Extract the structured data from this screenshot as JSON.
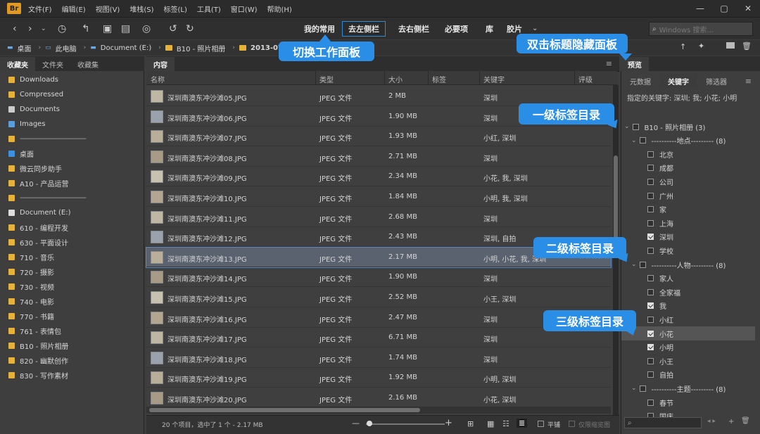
{
  "app": {
    "logo": "Br"
  },
  "menu": [
    "文件(F)",
    "编辑(E)",
    "视图(V)",
    "堆栈(S)",
    "标签(L)",
    "工具(T)",
    "窗口(W)",
    "帮助(H)"
  ],
  "workspaces": [
    "我的常用",
    "去左侧栏",
    "去右侧栏",
    "必要项",
    "库",
    "胶片"
  ],
  "active_workspace_index": 1,
  "search": {
    "placeholder": "Windows 搜索..."
  },
  "breadcrumb": [
    "桌面",
    "此电脑",
    "Document (E:)",
    "B10 - 照片相册",
    "2013-07-"
  ],
  "left_tabs": [
    "收藏夹",
    "文件夹",
    "收藏集"
  ],
  "favorites": [
    {
      "label": "Downloads",
      "icon": "folder-icon"
    },
    {
      "label": "Compressed",
      "icon": "folder-icon"
    },
    {
      "label": "Documents",
      "icon": "document-icon"
    },
    {
      "label": "Images",
      "icon": "image-icon"
    },
    {
      "label": "------------------------------------",
      "icon": "folder-icon",
      "sep": true
    },
    {
      "label": "桌面",
      "icon": "desktop-icon"
    },
    {
      "label": "微云同步助手",
      "icon": "folder-icon"
    },
    {
      "label": "A10 - 产品运营",
      "icon": "folder-icon"
    },
    {
      "label": "------------------------------------",
      "icon": "folder-icon",
      "sep": true
    },
    {
      "label": "Document (E:)",
      "icon": "drive-icon"
    },
    {
      "label": "610 - 编程开发",
      "icon": "folder-icon"
    },
    {
      "label": "630 - 平面设计",
      "icon": "folder-icon"
    },
    {
      "label": "710 - 音乐",
      "icon": "folder-icon"
    },
    {
      "label": "720 - 摄影",
      "icon": "folder-icon"
    },
    {
      "label": "730 - 视频",
      "icon": "folder-icon"
    },
    {
      "label": "740 - 电影",
      "icon": "folder-icon"
    },
    {
      "label": "770 - 书籍",
      "icon": "folder-icon"
    },
    {
      "label": "761 - 表情包",
      "icon": "folder-icon"
    },
    {
      "label": "B10 - 照片相册",
      "icon": "folder-icon"
    },
    {
      "label": "820 - 幽默创作",
      "icon": "folder-icon"
    },
    {
      "label": "830 - 写作素材",
      "icon": "folder-icon"
    }
  ],
  "content_tab": "内容",
  "columns": [
    "名称",
    "类型",
    "大小",
    "标签",
    "关键字",
    "评级"
  ],
  "files": [
    {
      "name": "深圳南澳东冲沙滩05.JPG",
      "type": "JPEG 文件",
      "size": "2 MB",
      "keywords": "深圳"
    },
    {
      "name": "深圳南澳东冲沙滩06.JPG",
      "type": "JPEG 文件",
      "size": "1.90 MB",
      "keywords": "深圳"
    },
    {
      "name": "深圳南澳东冲沙滩07.JPG",
      "type": "JPEG 文件",
      "size": "1.93 MB",
      "keywords": "小红, 深圳"
    },
    {
      "name": "深圳南澳东冲沙滩08.JPG",
      "type": "JPEG 文件",
      "size": "2.71 MB",
      "keywords": "深圳"
    },
    {
      "name": "深圳南澳东冲沙滩09.JPG",
      "type": "JPEG 文件",
      "size": "2.34 MB",
      "keywords": "小花, 我, 深圳"
    },
    {
      "name": "深圳南澳东冲沙滩10.JPG",
      "type": "JPEG 文件",
      "size": "1.84 MB",
      "keywords": "小明, 我, 深圳"
    },
    {
      "name": "深圳南澳东冲沙滩11.JPG",
      "type": "JPEG 文件",
      "size": "2.68 MB",
      "keywords": "深圳"
    },
    {
      "name": "深圳南澳东冲沙滩12.JPG",
      "type": "JPEG 文件",
      "size": "2.43 MB",
      "keywords": "深圳, 自拍"
    },
    {
      "name": "深圳南澳东冲沙滩13.JPG",
      "type": "JPEG 文件",
      "size": "2.17 MB",
      "keywords": "小明, 小花, 我, 深圳",
      "selected": true,
      "rating": "☆☆☆☆☆"
    },
    {
      "name": "深圳南澳东冲沙滩14.JPG",
      "type": "JPEG 文件",
      "size": "1.90 MB",
      "keywords": "深圳"
    },
    {
      "name": "深圳南澳东冲沙滩15.JPG",
      "type": "JPEG 文件",
      "size": "2.52 MB",
      "keywords": "小王, 深圳"
    },
    {
      "name": "深圳南澳东冲沙滩16.JPG",
      "type": "JPEG 文件",
      "size": "2.47 MB",
      "keywords": "深圳"
    },
    {
      "name": "深圳南澳东冲沙滩17.JPG",
      "type": "JPEG 文件",
      "size": "6.71 MB",
      "keywords": "深圳"
    },
    {
      "name": "深圳南澳东冲沙滩18.JPG",
      "type": "JPEG 文件",
      "size": "1.74 MB",
      "keywords": "深圳"
    },
    {
      "name": "深圳南澳东冲沙滩19.JPG",
      "type": "JPEG 文件",
      "size": "1.92 MB",
      "keywords": "小明, 深圳"
    },
    {
      "name": "深圳南澳东冲沙滩20.JPG",
      "type": "JPEG 文件",
      "size": "2.16 MB",
      "keywords": "小花, 深圳"
    }
  ],
  "status": {
    "text": "20 个项目，选中了 1 个 - 2.17 MB",
    "flat_label": "平铺",
    "thumb_only_label": "仅限缩览图"
  },
  "preview_tab": "预览",
  "right_tabs": [
    "元数据",
    "关键字",
    "筛选器"
  ],
  "active_right_tab": 1,
  "assigned_keywords": "指定的关键字: 深圳; 我; 小花; 小明",
  "keyword_tree": [
    {
      "label": "B10 - 照片相册 (3)",
      "level": 0,
      "checked": false,
      "expand": true
    },
    {
      "label": "----------地点--------- (8)",
      "level": 1,
      "checked": false,
      "expand": true
    },
    {
      "label": "北京",
      "level": 2,
      "checked": false
    },
    {
      "label": "成都",
      "level": 2,
      "checked": false
    },
    {
      "label": "公司",
      "level": 2,
      "checked": false
    },
    {
      "label": "广州",
      "level": 2,
      "checked": false
    },
    {
      "label": "家",
      "level": 2,
      "checked": false
    },
    {
      "label": "上海",
      "level": 2,
      "checked": false
    },
    {
      "label": "深圳",
      "level": 2,
      "checked": true
    },
    {
      "label": "学校",
      "level": 2,
      "checked": false
    },
    {
      "label": "----------人物--------- (8)",
      "level": 1,
      "checked": false,
      "expand": true
    },
    {
      "label": "家人",
      "level": 2,
      "checked": false
    },
    {
      "label": "全家福",
      "level": 2,
      "checked": false
    },
    {
      "label": "我",
      "level": 2,
      "checked": true
    },
    {
      "label": "小红",
      "level": 2,
      "checked": false
    },
    {
      "label": "小花",
      "level": 2,
      "checked": true,
      "highlight": true
    },
    {
      "label": "小明",
      "level": 2,
      "checked": true
    },
    {
      "label": "小王",
      "level": 2,
      "checked": false
    },
    {
      "label": "自拍",
      "level": 2,
      "checked": false
    },
    {
      "label": "----------主题--------- (8)",
      "level": 1,
      "checked": false,
      "expand": true
    },
    {
      "label": "春节",
      "level": 2,
      "checked": false
    },
    {
      "label": "国庆",
      "level": 2,
      "checked": false
    }
  ],
  "callouts": {
    "workspace": "切换工作面板",
    "hide_panel": "双击标题隐藏面板",
    "level1": "一级标签目录",
    "level2": "二级标签目录",
    "level3": "三级标签目录"
  },
  "colors": {
    "accent": "#2a8ee6",
    "folder": "#e6b23a"
  }
}
